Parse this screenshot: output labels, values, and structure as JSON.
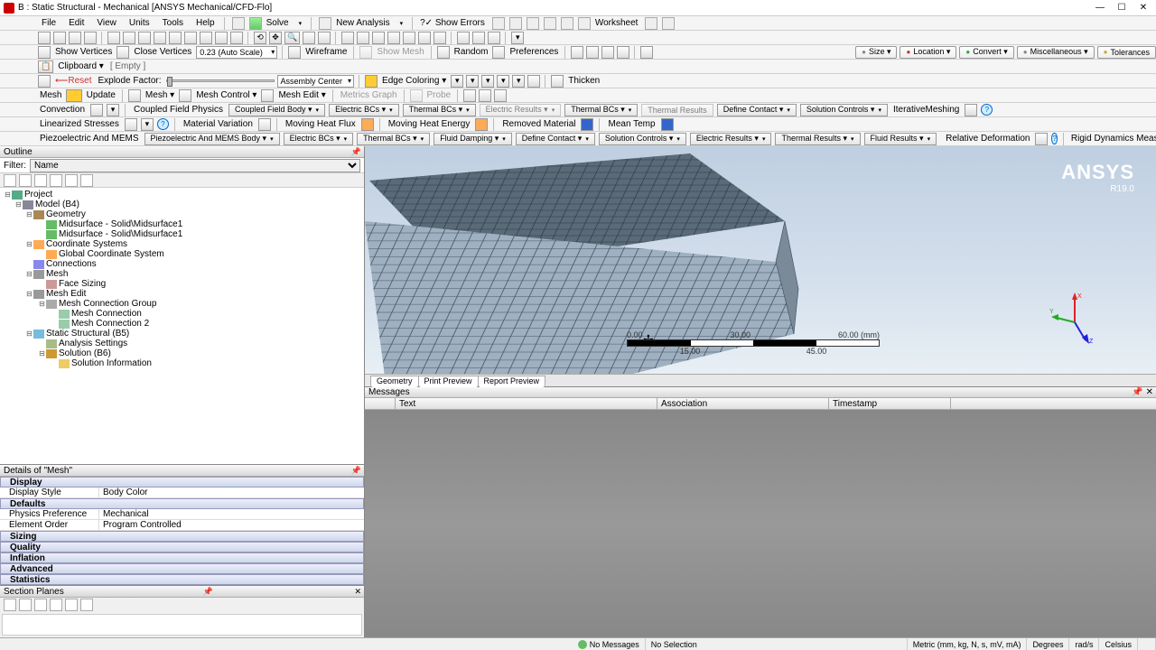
{
  "title": "B : Static Structural - Mechanical [ANSYS Mechanical/CFD-Flo]",
  "menus": [
    "File",
    "Edit",
    "View",
    "Units",
    "Tools",
    "Help"
  ],
  "mainbar": {
    "solve": "Solve",
    "new_analysis": "New Analysis",
    "show_errors": "?✓ Show Errors",
    "worksheet": "Worksheet"
  },
  "viewbar": {
    "show_vertices": "Show Vertices",
    "close_vertices": "Close Vertices",
    "autoscale": "0.23 (Auto Scale)",
    "wireframe": "Wireframe",
    "show_mesh": "Show Mesh",
    "random": "Random",
    "preferences": "Preferences",
    "size": "Size ▾",
    "location": "Location ▾",
    "convert": "Convert ▾",
    "misc": "Miscellaneous ▾",
    "tol": "Tolerances"
  },
  "clipboard": {
    "label": "Clipboard ▾",
    "empty": "[ Empty ]"
  },
  "explode": {
    "reset": "Reset",
    "label": "Explode Factor:",
    "assembly": "Assembly Center",
    "edge_coloring": "Edge Coloring ▾",
    "thicken": "Thicken"
  },
  "meshbar": {
    "mesh": "Mesh",
    "update": "Update",
    "mesh_dd": "Mesh ▾",
    "mesh_control": "Mesh Control ▾",
    "mesh_edit": "Mesh Edit ▾",
    "metrics": "Metrics Graph",
    "probe": "Probe"
  },
  "r1": {
    "convection": "Convection",
    "cfp": "Coupled Field Physics",
    "cfb": "Coupled Field Body ▾",
    "ebc": "Electric BCs ▾",
    "tbc": "Thermal BCs ▾",
    "eres": "Electric Results ▾",
    "tbc2": "Thermal BCs ▾",
    "tres": "Thermal Results",
    "dc": "Define Contact ▾",
    "sc": "Solution Controls ▾",
    "im": "IterativeMeshing"
  },
  "r2": {
    "ls": "Linearized Stresses",
    "mv": "Material Variation",
    "mhf": "Moving Heat Flux",
    "mhe": "Moving Heat Energy",
    "rm": "Removed Material",
    "mt": "Mean Temp"
  },
  "r3": {
    "pm": "Piezoelectric And MEMS",
    "pmb": "Piezoelectric And MEMS Body ▾",
    "ebc": "Electric BCs ▾",
    "tbc": "Thermal BCs ▾",
    "fd": "Fluid Damping ▾",
    "dc": "Define Contact ▾",
    "sc": "Solution Controls ▾",
    "er": "Electric Results ▾",
    "tr": "Thermal Results ▾",
    "fr": "Fluid Results ▾",
    "rd": "Relative Deformation",
    "rdm": "Rigid Dynamics Measures"
  },
  "outline": {
    "title": "Outline",
    "filter_label": "Filter:",
    "filter_value": "Name",
    "tree": [
      {
        "lvl": 0,
        "exp": "-",
        "ico": "prj",
        "t": "Project"
      },
      {
        "lvl": 1,
        "exp": "-",
        "ico": "mdl",
        "t": "Model (B4)"
      },
      {
        "lvl": 2,
        "exp": "-",
        "ico": "geo",
        "t": "Geometry"
      },
      {
        "lvl": 3,
        "exp": "",
        "ico": "srf",
        "t": "Midsurface - Solid\\Midsurface1"
      },
      {
        "lvl": 3,
        "exp": "",
        "ico": "srf",
        "t": "Midsurface - Solid\\Midsurface1"
      },
      {
        "lvl": 2,
        "exp": "-",
        "ico": "cs",
        "t": "Coordinate Systems"
      },
      {
        "lvl": 3,
        "exp": "",
        "ico": "cs",
        "t": "Global Coordinate System"
      },
      {
        "lvl": 2,
        "exp": "",
        "ico": "con",
        "t": "Connections"
      },
      {
        "lvl": 2,
        "exp": "-",
        "ico": "msh",
        "t": "Mesh"
      },
      {
        "lvl": 3,
        "exp": "",
        "ico": "fs",
        "t": "Face Sizing"
      },
      {
        "lvl": 2,
        "exp": "-",
        "ico": "msh",
        "t": "Mesh Edit"
      },
      {
        "lvl": 3,
        "exp": "-",
        "ico": "mcg",
        "t": "Mesh Connection Group"
      },
      {
        "lvl": 4,
        "exp": "",
        "ico": "mc",
        "t": "Mesh Connection"
      },
      {
        "lvl": 4,
        "exp": "",
        "ico": "mc",
        "t": "Mesh Connection 2"
      },
      {
        "lvl": 2,
        "exp": "-",
        "ico": "ss",
        "t": "Static Structural (B5)"
      },
      {
        "lvl": 3,
        "exp": "",
        "ico": "as",
        "t": "Analysis Settings"
      },
      {
        "lvl": 3,
        "exp": "-",
        "ico": "sol",
        "t": "Solution (B6)"
      },
      {
        "lvl": 4,
        "exp": "",
        "ico": "si",
        "t": "Solution Information"
      }
    ]
  },
  "details": {
    "title": "Details of \"Mesh\"",
    "cats": {
      "display": "Display",
      "defaults": "Defaults",
      "sizing": "Sizing",
      "quality": "Quality",
      "inflation": "Inflation",
      "advanced": "Advanced",
      "statistics": "Statistics"
    },
    "display_style_l": "Display Style",
    "display_style_v": "Body Color",
    "physics_l": "Physics Preference",
    "physics_v": "Mechanical",
    "element_l": "Element Order",
    "element_v": "Program Controlled"
  },
  "section_planes": {
    "title": "Section Planes"
  },
  "brand": {
    "name": "ANSYS",
    "ver": "R19.0"
  },
  "ruler": {
    "u0": "0.00",
    "u1": "30.00",
    "u2": "60.00 (mm)",
    "l0": "15.00",
    "l1": "45.00"
  },
  "tabs3d": {
    "g": "Geometry",
    "p": "Print Preview",
    "r": "Report Preview"
  },
  "messages": {
    "title": "Messages",
    "c1": "Text",
    "c2": "Association",
    "c3": "Timestamp"
  },
  "status": {
    "nomsg": "No Messages",
    "nosel": "No Selection",
    "units": "Metric (mm, kg, N, s, mV, mA)",
    "deg": "Degrees",
    "rad": "rad/s",
    "cel": "Celsius"
  }
}
